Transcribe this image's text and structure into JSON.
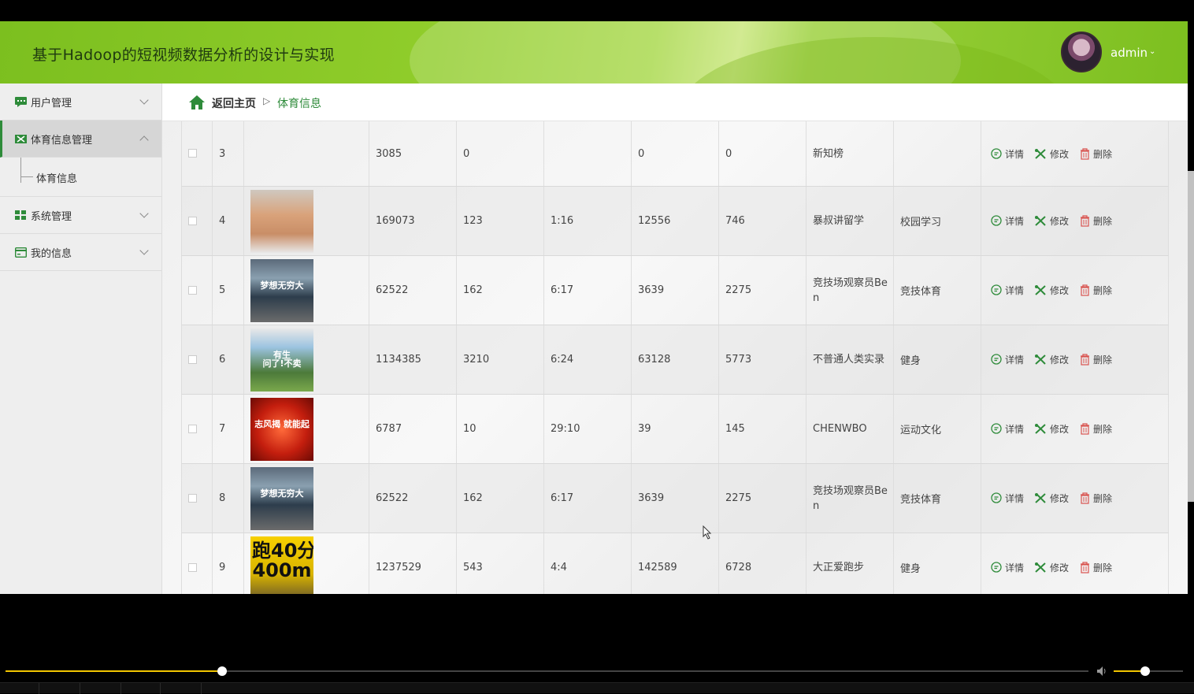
{
  "header": {
    "title": "基于Hadoop的短视频数据分析的设计与实现",
    "user": "admin"
  },
  "sidebar": {
    "items": [
      {
        "label": "用户管理",
        "icon": "chat-icon",
        "expanded": false
      },
      {
        "label": "体育信息管理",
        "icon": "ticket-icon",
        "expanded": true
      },
      {
        "label": "系统管理",
        "icon": "grid-icon",
        "expanded": false
      },
      {
        "label": "我的信息",
        "icon": "card-icon",
        "expanded": false
      }
    ],
    "submenu": {
      "label": "体育信息"
    }
  },
  "breadcrumb": {
    "home": "返回主页",
    "separator": "▷",
    "current": "体育信息"
  },
  "actions": {
    "detail": "详情",
    "edit": "修改",
    "delete": "删除"
  },
  "rows": [
    {
      "id": "3",
      "thumb": "",
      "c1": "3085",
      "c2": "0",
      "c3": "",
      "c4": "0",
      "c5": "0",
      "author": "新知榜",
      "category": ""
    },
    {
      "id": "4",
      "thumb": "face",
      "c1": "169073",
      "c2": "123",
      "c3": "1:16",
      "c4": "12556",
      "c5": "746",
      "author": "暴叔讲留学",
      "category": "校园学习"
    },
    {
      "id": "5",
      "thumb": "dream",
      "c1": "62522",
      "c2": "162",
      "c3": "6:17",
      "c4": "3639",
      "c5": "2275",
      "author": "竞技场观察员Ben",
      "category": "竞技体育"
    },
    {
      "id": "6",
      "thumb": "field",
      "c1": "1134385",
      "c2": "3210",
      "c3": "6:24",
      "c4": "63128",
      "c5": "5773",
      "author": "不普通人类实录",
      "category": "健身"
    },
    {
      "id": "7",
      "thumb": "red",
      "c1": "6787",
      "c2": "10",
      "c3": "29:10",
      "c4": "39",
      "c5": "145",
      "author": "CHENWBO",
      "category": "运动文化"
    },
    {
      "id": "8",
      "thumb": "dream",
      "c1": "62522",
      "c2": "162",
      "c3": "6:17",
      "c4": "3639",
      "c5": "2275",
      "author": "竞技场观察员Ben",
      "category": "竞技体育"
    },
    {
      "id": "9",
      "thumb": "run",
      "c1": "1237529",
      "c2": "543",
      "c3": "4:4",
      "c4": "142589",
      "c5": "6728",
      "author": "大正爱跑步",
      "category": "健身"
    }
  ],
  "thumb_text": {
    "dream": "梦想无穷大",
    "field": "有生\n问了!不卖",
    "red": "志风揭 就能起",
    "run": "跑40分\n400m"
  },
  "player": {
    "seek_progress": 0.2,
    "volume": 0.45
  },
  "colors": {
    "accent": "#2e8b3a",
    "header_green": "#8fcc2a",
    "seek": "#f2c500"
  }
}
